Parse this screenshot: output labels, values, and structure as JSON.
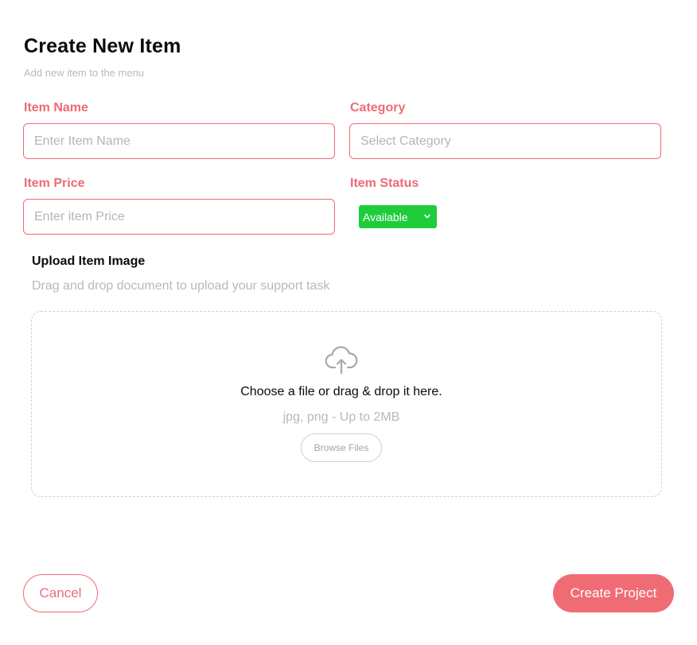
{
  "header": {
    "title": "Create New Item",
    "subtitle": "Add new item to the menu"
  },
  "form": {
    "item_name": {
      "label": "Item Name",
      "placeholder": "Enter Item Name",
      "value": ""
    },
    "category": {
      "label": "Category",
      "placeholder": "Select Category",
      "value": ""
    },
    "item_price": {
      "label": "Item Price",
      "placeholder": "Enter item Price",
      "value": ""
    },
    "item_status": {
      "label": "Item Status",
      "selected": "Available",
      "color": "#1fcc3c"
    }
  },
  "upload": {
    "title": "Upload Item Image",
    "subtitle": "Drag and drop document to upload your support task",
    "icon": "cloud-upload-icon",
    "prompt": "Choose a file or drag & drop it here.",
    "hint": "jpg, png - Up to 2MB",
    "browse_label": "Browse Files"
  },
  "actions": {
    "cancel_label": "Cancel",
    "create_label": "Create Project"
  },
  "colors": {
    "accent": "#ee6b73",
    "muted": "#b9b9b9",
    "success": "#1fcc3c"
  }
}
